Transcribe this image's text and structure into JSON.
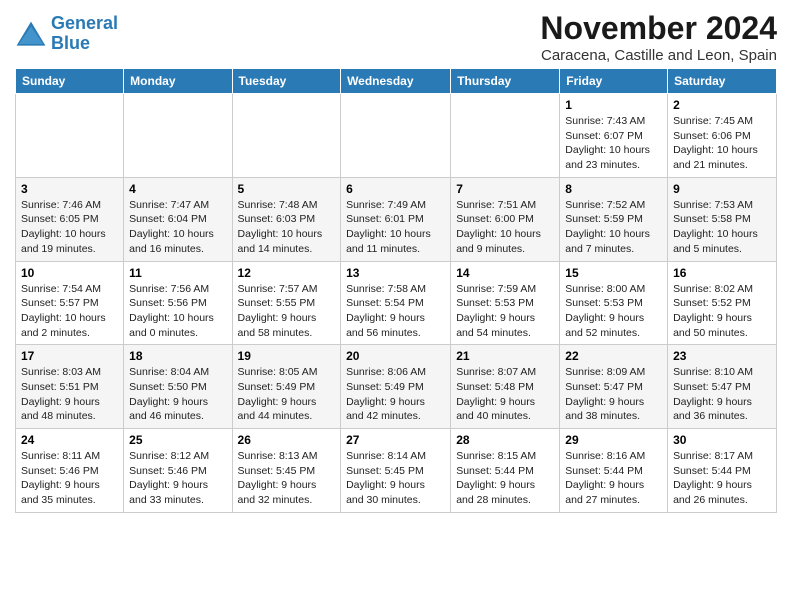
{
  "header": {
    "logo_line1": "General",
    "logo_line2": "Blue",
    "month_title": "November 2024",
    "location": "Caracena, Castille and Leon, Spain"
  },
  "days_of_week": [
    "Sunday",
    "Monday",
    "Tuesday",
    "Wednesday",
    "Thursday",
    "Friday",
    "Saturday"
  ],
  "weeks": [
    [
      {
        "day": "",
        "info": ""
      },
      {
        "day": "",
        "info": ""
      },
      {
        "day": "",
        "info": ""
      },
      {
        "day": "",
        "info": ""
      },
      {
        "day": "",
        "info": ""
      },
      {
        "day": "1",
        "info": "Sunrise: 7:43 AM\nSunset: 6:07 PM\nDaylight: 10 hours and 23 minutes."
      },
      {
        "day": "2",
        "info": "Sunrise: 7:45 AM\nSunset: 6:06 PM\nDaylight: 10 hours and 21 minutes."
      }
    ],
    [
      {
        "day": "3",
        "info": "Sunrise: 7:46 AM\nSunset: 6:05 PM\nDaylight: 10 hours and 19 minutes."
      },
      {
        "day": "4",
        "info": "Sunrise: 7:47 AM\nSunset: 6:04 PM\nDaylight: 10 hours and 16 minutes."
      },
      {
        "day": "5",
        "info": "Sunrise: 7:48 AM\nSunset: 6:03 PM\nDaylight: 10 hours and 14 minutes."
      },
      {
        "day": "6",
        "info": "Sunrise: 7:49 AM\nSunset: 6:01 PM\nDaylight: 10 hours and 11 minutes."
      },
      {
        "day": "7",
        "info": "Sunrise: 7:51 AM\nSunset: 6:00 PM\nDaylight: 10 hours and 9 minutes."
      },
      {
        "day": "8",
        "info": "Sunrise: 7:52 AM\nSunset: 5:59 PM\nDaylight: 10 hours and 7 minutes."
      },
      {
        "day": "9",
        "info": "Sunrise: 7:53 AM\nSunset: 5:58 PM\nDaylight: 10 hours and 5 minutes."
      }
    ],
    [
      {
        "day": "10",
        "info": "Sunrise: 7:54 AM\nSunset: 5:57 PM\nDaylight: 10 hours and 2 minutes."
      },
      {
        "day": "11",
        "info": "Sunrise: 7:56 AM\nSunset: 5:56 PM\nDaylight: 10 hours and 0 minutes."
      },
      {
        "day": "12",
        "info": "Sunrise: 7:57 AM\nSunset: 5:55 PM\nDaylight: 9 hours and 58 minutes."
      },
      {
        "day": "13",
        "info": "Sunrise: 7:58 AM\nSunset: 5:54 PM\nDaylight: 9 hours and 56 minutes."
      },
      {
        "day": "14",
        "info": "Sunrise: 7:59 AM\nSunset: 5:53 PM\nDaylight: 9 hours and 54 minutes."
      },
      {
        "day": "15",
        "info": "Sunrise: 8:00 AM\nSunset: 5:53 PM\nDaylight: 9 hours and 52 minutes."
      },
      {
        "day": "16",
        "info": "Sunrise: 8:02 AM\nSunset: 5:52 PM\nDaylight: 9 hours and 50 minutes."
      }
    ],
    [
      {
        "day": "17",
        "info": "Sunrise: 8:03 AM\nSunset: 5:51 PM\nDaylight: 9 hours and 48 minutes."
      },
      {
        "day": "18",
        "info": "Sunrise: 8:04 AM\nSunset: 5:50 PM\nDaylight: 9 hours and 46 minutes."
      },
      {
        "day": "19",
        "info": "Sunrise: 8:05 AM\nSunset: 5:49 PM\nDaylight: 9 hours and 44 minutes."
      },
      {
        "day": "20",
        "info": "Sunrise: 8:06 AM\nSunset: 5:49 PM\nDaylight: 9 hours and 42 minutes."
      },
      {
        "day": "21",
        "info": "Sunrise: 8:07 AM\nSunset: 5:48 PM\nDaylight: 9 hours and 40 minutes."
      },
      {
        "day": "22",
        "info": "Sunrise: 8:09 AM\nSunset: 5:47 PM\nDaylight: 9 hours and 38 minutes."
      },
      {
        "day": "23",
        "info": "Sunrise: 8:10 AM\nSunset: 5:47 PM\nDaylight: 9 hours and 36 minutes."
      }
    ],
    [
      {
        "day": "24",
        "info": "Sunrise: 8:11 AM\nSunset: 5:46 PM\nDaylight: 9 hours and 35 minutes."
      },
      {
        "day": "25",
        "info": "Sunrise: 8:12 AM\nSunset: 5:46 PM\nDaylight: 9 hours and 33 minutes."
      },
      {
        "day": "26",
        "info": "Sunrise: 8:13 AM\nSunset: 5:45 PM\nDaylight: 9 hours and 32 minutes."
      },
      {
        "day": "27",
        "info": "Sunrise: 8:14 AM\nSunset: 5:45 PM\nDaylight: 9 hours and 30 minutes."
      },
      {
        "day": "28",
        "info": "Sunrise: 8:15 AM\nSunset: 5:44 PM\nDaylight: 9 hours and 28 minutes."
      },
      {
        "day": "29",
        "info": "Sunrise: 8:16 AM\nSunset: 5:44 PM\nDaylight: 9 hours and 27 minutes."
      },
      {
        "day": "30",
        "info": "Sunrise: 8:17 AM\nSunset: 5:44 PM\nDaylight: 9 hours and 26 minutes."
      }
    ]
  ]
}
